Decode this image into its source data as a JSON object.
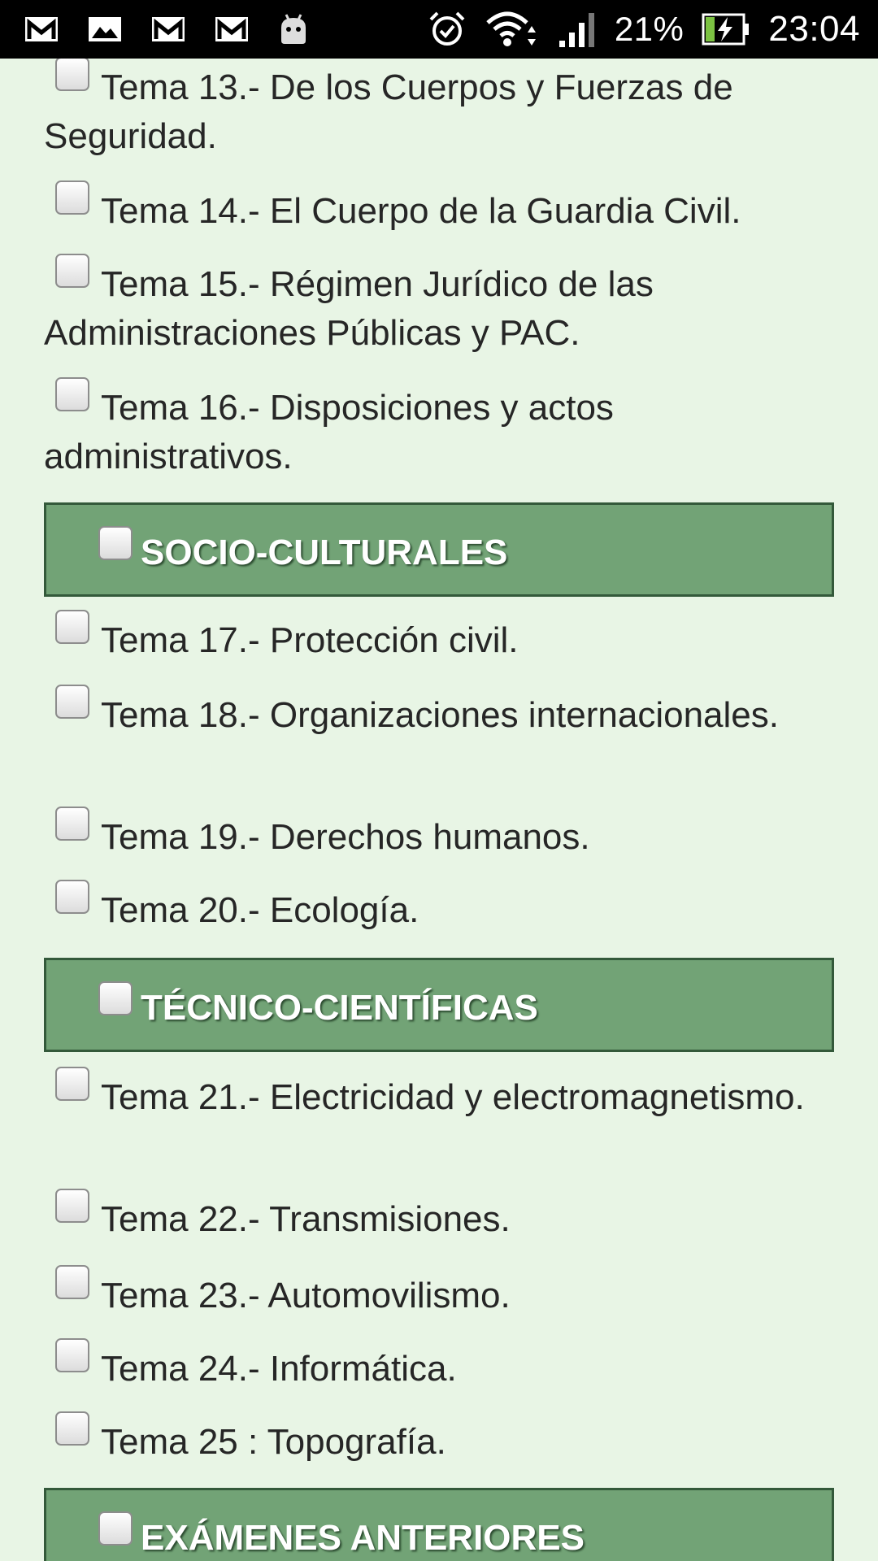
{
  "status_bar": {
    "left_icons": [
      "gmail-icon",
      "photo-notification-icon",
      "gmail-icon",
      "gmail-icon",
      "android-icon"
    ],
    "battery_percent": "21%",
    "time": "23:04"
  },
  "items": [
    {
      "label": "Tema 13.- De los Cuerpos y Fuerzas de Seguridad."
    },
    {
      "label": "Tema 14.- El Cuerpo de la Guardia Civil."
    },
    {
      "label": "Tema 15.- Régimen Jurídico de las Administraciones Públicas y PAC."
    },
    {
      "label": "Tema 16.- Disposiciones y actos administrativos."
    }
  ],
  "sections": [
    {
      "label": "SOCIO-CULTURALES"
    },
    {
      "label": "TÉCNICO-CIENTÍFICAS"
    },
    {
      "label": "EXÁMENES ANTERIORES"
    }
  ],
  "socio_items": [
    {
      "label": "Tema 17.- Protección civil."
    },
    {
      "label": "Tema 18.- Organizaciones internacionales."
    },
    {
      "label": "Tema 19.- Derechos humanos."
    },
    {
      "label": "Tema 20.- Ecología."
    }
  ],
  "tecnico_items": [
    {
      "label": "Tema 21.- Electricidad y electromagnetismo."
    },
    {
      "label": "Tema 22.- Transmisiones."
    },
    {
      "label": "Tema 23.- Automovilismo."
    },
    {
      "label": "Tema 24.- Informática."
    },
    {
      "label": "Tema 25 : Topografía."
    }
  ]
}
